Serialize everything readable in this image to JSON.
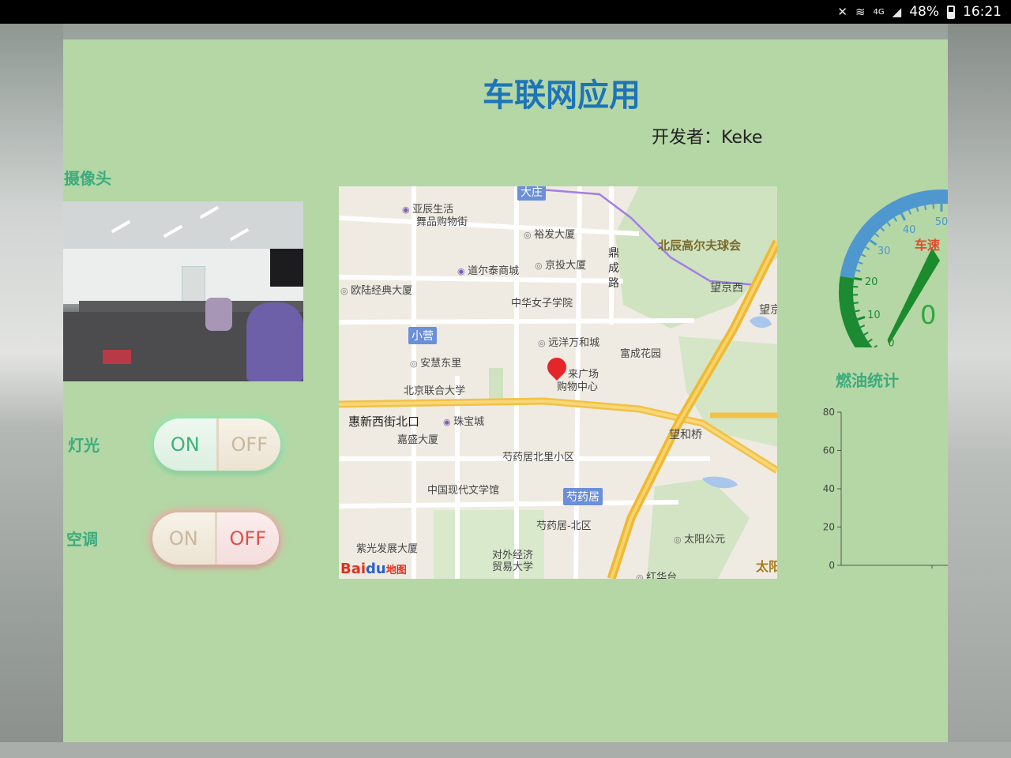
{
  "status_bar": {
    "network": "4G",
    "battery": "48%",
    "time": "16:21"
  },
  "app": {
    "title": "车联网应用",
    "developer_label": "开发者：",
    "developer_name": "Keke"
  },
  "camera": {
    "label": "摄像头"
  },
  "controls": {
    "light": {
      "label": "灯光",
      "on_label": "ON",
      "off_label": "OFF",
      "state": "ON"
    },
    "ac": {
      "label": "空调",
      "on_label": "ON",
      "off_label": "OFF",
      "state": "OFF"
    }
  },
  "map": {
    "labels": {
      "l1": "大庄",
      "l2": "亚辰生活",
      "l3": "舞品购物街",
      "l4": "裕发大厦",
      "l5": "道尔泰商城",
      "l6": "京投大厦",
      "l7": "鼎",
      "l8": "成",
      "l9": "路",
      "l10": "北辰高尔夫球会",
      "l11": "欧陆经典大厦",
      "l12": "中华女子学院",
      "l13": "望京西",
      "l14": "望京",
      "l15": "小营",
      "l16": "远洋万和城",
      "l17": "富成花园",
      "l18": "安慧东里",
      "l19": "北辰购物中心",
      "l20": "来广场",
      "l21": "购物中心",
      "l22": "北京联合大学",
      "l23": "惠新西街北口",
      "l24": "珠宝城",
      "l25": "望和桥",
      "l26": "嘉盛大厦",
      "l27": "芍药居北里小区",
      "l28": "中国现代文学馆",
      "l29": "芍药居",
      "l30": "芍药居-北区",
      "l31": "紫光发展大厦",
      "l32": "对外经济",
      "l33": "贸易大学",
      "l34": "太阳公元",
      "l35": "太阳",
      "l36": "红华台"
    },
    "logo_text": "Bai",
    "logo_paw": "du",
    "logo_ditu": "地图"
  },
  "gauge": {
    "label": "车速",
    "value": "0",
    "min": 0,
    "max": 50,
    "ticks": [
      "0",
      "10",
      "20",
      "30",
      "40",
      "50"
    ],
    "colors": {
      "low": "#1b8a32",
      "high": "#4f97cf",
      "needle": "#1c8b2c"
    }
  },
  "fuel": {
    "label": "燃油统计",
    "chart_data": {
      "type": "bar",
      "title": "燃油统计",
      "categories": [],
      "values": [],
      "ylim": [
        0,
        80
      ],
      "yticks": [
        "0",
        "20",
        "40",
        "60",
        "80"
      ]
    }
  }
}
